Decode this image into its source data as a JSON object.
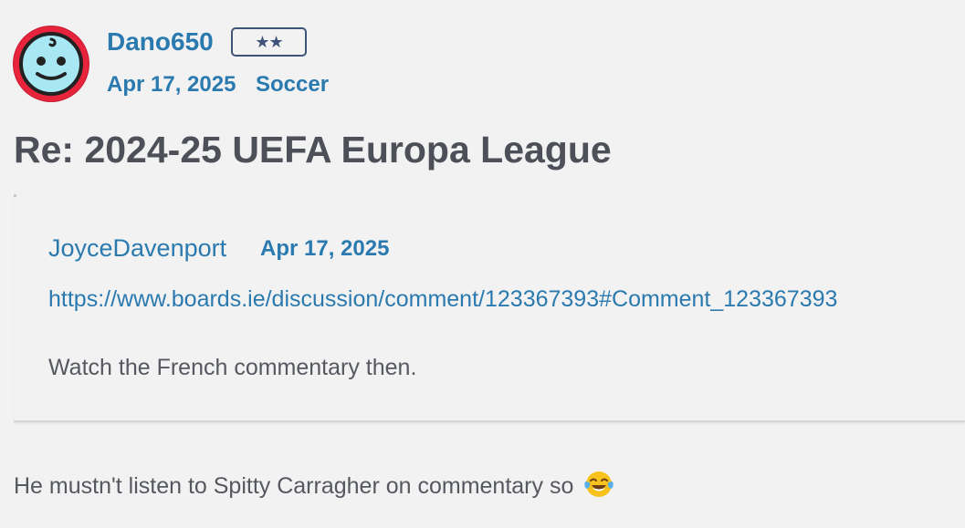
{
  "post": {
    "author": "Dano650",
    "rank_badge": "★★",
    "date": "Apr 17, 2025",
    "category": "Soccer",
    "title": "Re: 2024-25 UEFA Europa League",
    "body_text": "He mustn't listen to Spitty Carragher on commentary so",
    "body_emoji": "face-with-tears-of-joy-icon"
  },
  "quote": {
    "author": "JoyceDavenport",
    "date": "Apr 17, 2025",
    "link": "https://www.boards.ie/discussion/comment/123367393#Comment_123367393",
    "text": "Watch the French commentary then."
  },
  "colors": {
    "link_blue": "#2a7ab0",
    "title_gray": "#4d5058",
    "text_gray": "#55585f",
    "background": "#f2f2f2",
    "avatar_ring": "#e8243c",
    "avatar_face": "#a8e8f4",
    "badge_border": "#3e5478"
  }
}
